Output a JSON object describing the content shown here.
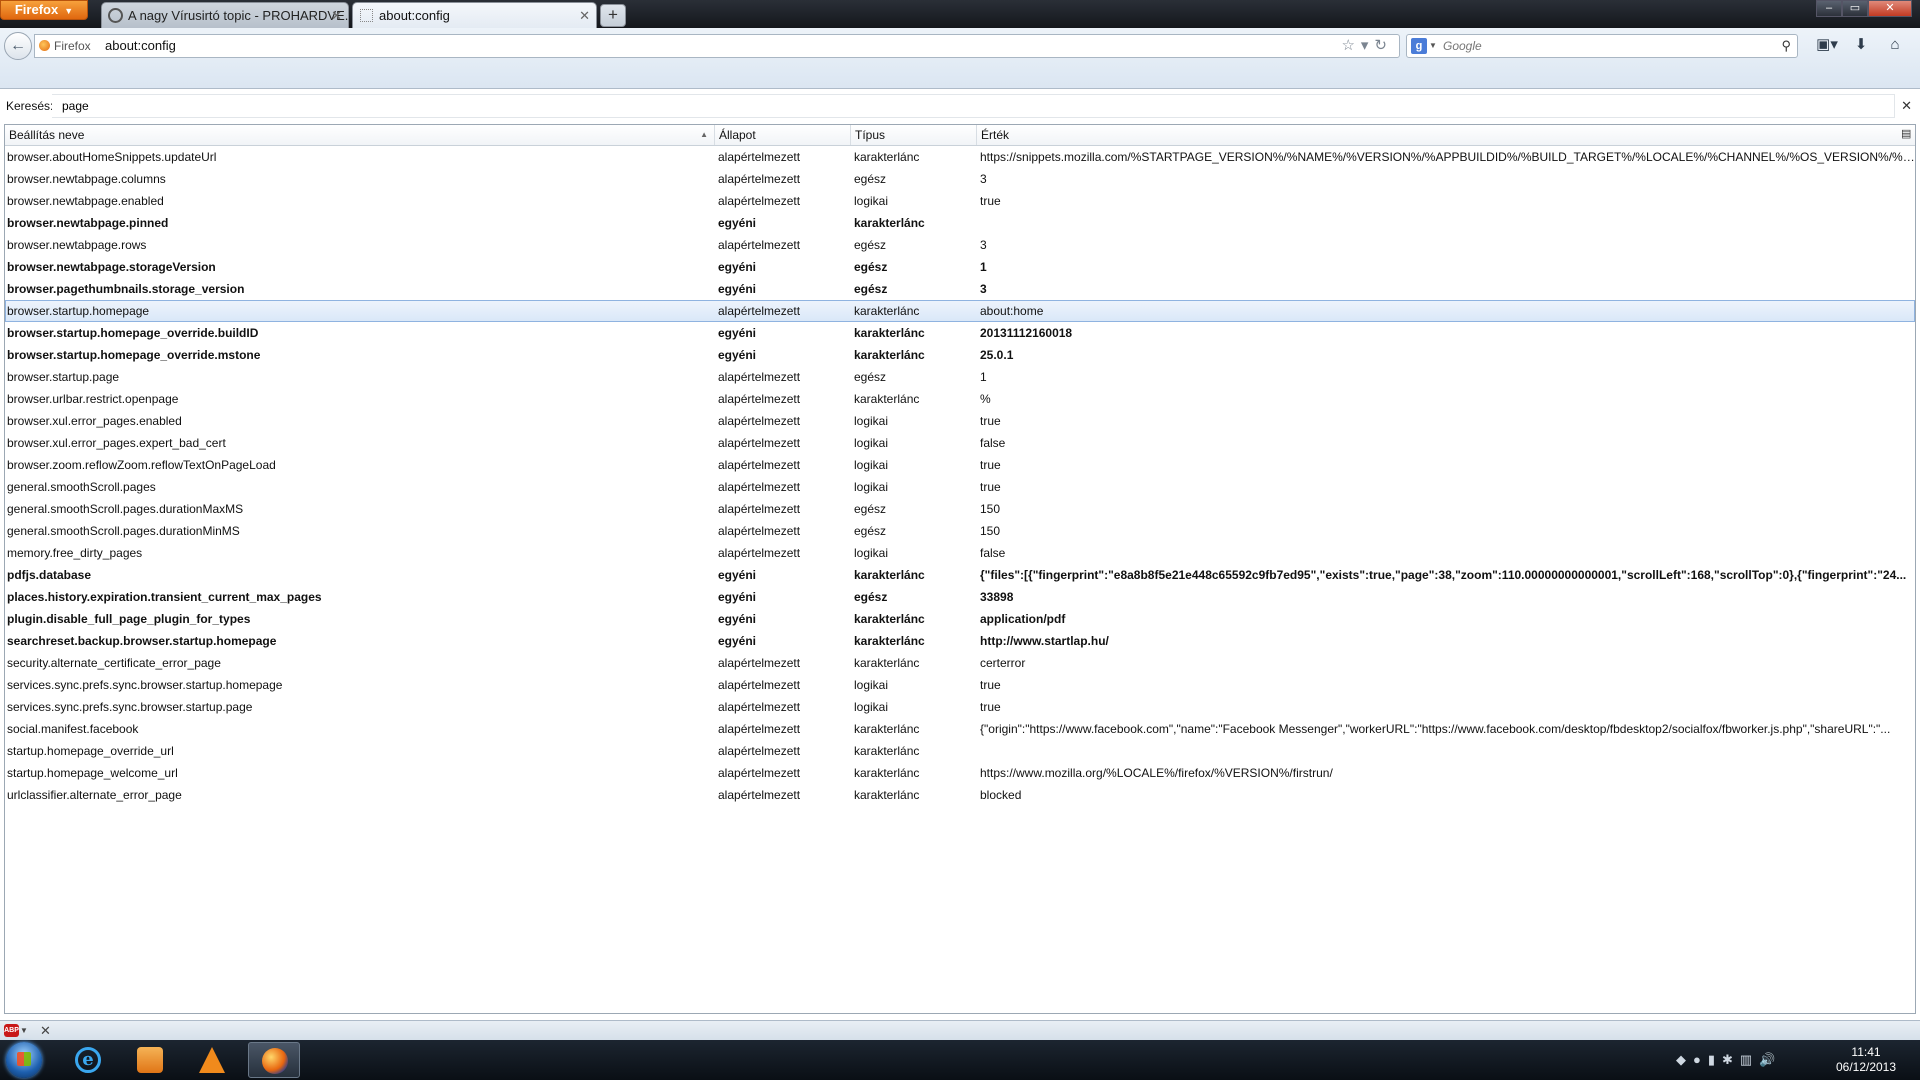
{
  "window": {
    "menu_button": "Firefox",
    "tabs": [
      {
        "title": "A nagy Vírusirtó topic - PROHARDVE..."
      },
      {
        "title": "about:config"
      }
    ],
    "new_tab_label": "+",
    "controls": {
      "minimize": "‒",
      "maximize": "▭",
      "close": "✕"
    }
  },
  "navbar": {
    "back_icon": "←",
    "identity_label": "Firefox",
    "url": "about:config",
    "url_icons": "☆▾↻",
    "search_placeholder": "Google",
    "search_engine_icon": "g",
    "toolbar_icons": [
      "▣▾",
      "⬇",
      "⌂"
    ]
  },
  "config": {
    "filter_label": "Keresés:",
    "filter_value": "page",
    "columns": {
      "name": "Beállítás neve",
      "status": "Állapot",
      "type": "Típus",
      "value": "Érték"
    },
    "rows": [
      {
        "name": "browser.aboutHomeSnippets.updateUrl",
        "status": "alapértelmezett",
        "type": "karakterlánc",
        "value": "https://snippets.mozilla.com/%STARTPAGE_VERSION%/%NAME%/%VERSION%/%APPBUILDID%/%BUILD_TARGET%/%LOCALE%/%CHANNEL%/%OS_VERSION%/%DISTRIBU...",
        "modified": false
      },
      {
        "name": "browser.newtabpage.columns",
        "status": "alapértelmezett",
        "type": "egész",
        "value": "3",
        "modified": false
      },
      {
        "name": "browser.newtabpage.enabled",
        "status": "alapértelmezett",
        "type": "logikai",
        "value": "true",
        "modified": false
      },
      {
        "name": "browser.newtabpage.pinned",
        "status": "egyéni",
        "type": "karakterlánc",
        "value": "",
        "modified": true
      },
      {
        "name": "browser.newtabpage.rows",
        "status": "alapértelmezett",
        "type": "egész",
        "value": "3",
        "modified": false
      },
      {
        "name": "browser.newtabpage.storageVersion",
        "status": "egyéni",
        "type": "egész",
        "value": "1",
        "modified": true
      },
      {
        "name": "browser.pagethumbnails.storage_version",
        "status": "egyéni",
        "type": "egész",
        "value": "3",
        "modified": true
      },
      {
        "name": "browser.startup.homepage",
        "status": "alapértelmezett",
        "type": "karakterlánc",
        "value": "about:home",
        "modified": false,
        "selected": true
      },
      {
        "name": "browser.startup.homepage_override.buildID",
        "status": "egyéni",
        "type": "karakterlánc",
        "value": "20131112160018",
        "modified": true
      },
      {
        "name": "browser.startup.homepage_override.mstone",
        "status": "egyéni",
        "type": "karakterlánc",
        "value": "25.0.1",
        "modified": true
      },
      {
        "name": "browser.startup.page",
        "status": "alapértelmezett",
        "type": "egész",
        "value": "1",
        "modified": false
      },
      {
        "name": "browser.urlbar.restrict.openpage",
        "status": "alapértelmezett",
        "type": "karakterlánc",
        "value": "%",
        "modified": false
      },
      {
        "name": "browser.xul.error_pages.enabled",
        "status": "alapértelmezett",
        "type": "logikai",
        "value": "true",
        "modified": false
      },
      {
        "name": "browser.xul.error_pages.expert_bad_cert",
        "status": "alapértelmezett",
        "type": "logikai",
        "value": "false",
        "modified": false
      },
      {
        "name": "browser.zoom.reflowZoom.reflowTextOnPageLoad",
        "status": "alapértelmezett",
        "type": "logikai",
        "value": "true",
        "modified": false
      },
      {
        "name": "general.smoothScroll.pages",
        "status": "alapértelmezett",
        "type": "logikai",
        "value": "true",
        "modified": false
      },
      {
        "name": "general.smoothScroll.pages.durationMaxMS",
        "status": "alapértelmezett",
        "type": "egész",
        "value": "150",
        "modified": false
      },
      {
        "name": "general.smoothScroll.pages.durationMinMS",
        "status": "alapértelmezett",
        "type": "egész",
        "value": "150",
        "modified": false
      },
      {
        "name": "memory.free_dirty_pages",
        "status": "alapértelmezett",
        "type": "logikai",
        "value": "false",
        "modified": false
      },
      {
        "name": "pdfjs.database",
        "status": "egyéni",
        "type": "karakterlánc",
        "value": "{\"files\":[{\"fingerprint\":\"e8a8b8f5e21e448c65592c9fb7ed95\",\"exists\":true,\"page\":38,\"zoom\":110.00000000000001,\"scrollLeft\":168,\"scrollTop\":0},{\"fingerprint\":\"24...",
        "modified": true
      },
      {
        "name": "places.history.expiration.transient_current_max_pages",
        "status": "egyéni",
        "type": "egész",
        "value": "33898",
        "modified": true
      },
      {
        "name": "plugin.disable_full_page_plugin_for_types",
        "status": "egyéni",
        "type": "karakterlánc",
        "value": "application/pdf",
        "modified": true
      },
      {
        "name": "searchreset.backup.browser.startup.homepage",
        "status": "egyéni",
        "type": "karakterlánc",
        "value": "http://www.startlap.hu/",
        "modified": true
      },
      {
        "name": "security.alternate_certificate_error_page",
        "status": "alapértelmezett",
        "type": "karakterlánc",
        "value": "certerror",
        "modified": false
      },
      {
        "name": "services.sync.prefs.sync.browser.startup.homepage",
        "status": "alapértelmezett",
        "type": "logikai",
        "value": "true",
        "modified": false
      },
      {
        "name": "services.sync.prefs.sync.browser.startup.page",
        "status": "alapértelmezett",
        "type": "logikai",
        "value": "true",
        "modified": false
      },
      {
        "name": "social.manifest.facebook",
        "status": "alapértelmezett",
        "type": "karakterlánc",
        "value": "{\"origin\":\"https://www.facebook.com\",\"name\":\"Facebook Messenger\",\"workerURL\":\"https://www.facebook.com/desktop/fbdesktop2/socialfox/fbworker.js.php\",\"shareURL\":\"...",
        "modified": false
      },
      {
        "name": "startup.homepage_override_url",
        "status": "alapértelmezett",
        "type": "karakterlánc",
        "value": "",
        "modified": false
      },
      {
        "name": "startup.homepage_welcome_url",
        "status": "alapértelmezett",
        "type": "karakterlánc",
        "value": "https://www.mozilla.org/%LOCALE%/firefox/%VERSION%/firstrun/",
        "modified": false
      },
      {
        "name": "urlclassifier.alternate_error_page",
        "status": "alapértelmezett",
        "type": "karakterlánc",
        "value": "blocked",
        "modified": false
      }
    ]
  },
  "addonbar": {
    "abp_label": "ABP",
    "close": "✕"
  },
  "taskbar": {
    "apps": [
      "internet-explorer",
      "media-player",
      "vlc",
      "firefox"
    ],
    "ie_glyph": "e",
    "tray_icons": "◆●▮✱▥🔊",
    "time": "11:41",
    "date": "06/12/2013"
  },
  "colors": {
    "accent": "#e0670f",
    "selection": "#d9e7f8",
    "taskbar": "#0a0f15"
  }
}
